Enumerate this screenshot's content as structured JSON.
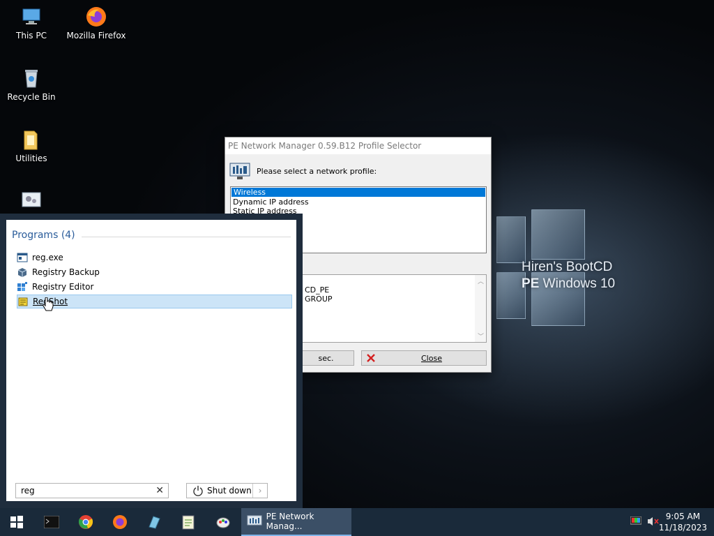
{
  "desktop": {
    "icons": [
      {
        "label": "This PC",
        "icon": "computer-icon"
      },
      {
        "label": "Mozilla Firefox",
        "icon": "firefox-icon"
      },
      {
        "label": "Recycle Bin",
        "icon": "recycle-bin-icon"
      },
      {
        "label": "Utilities",
        "icon": "folder-icon"
      }
    ],
    "brand": {
      "line1": "Hiren's BootCD",
      "line2": "PE Windows 10"
    }
  },
  "dialog": {
    "title": "PE Network Manager 0.59.B12 Profile Selector",
    "prompt": "Please select a network profile:",
    "profiles": [
      "Wireless",
      "Dynamic IP address",
      "Static IP address"
    ],
    "selected_profile": "Wireless",
    "info_lines": [
      "CD_PE",
      "GROUP"
    ],
    "partial_button": "sec.",
    "close_button": "Close"
  },
  "start_menu": {
    "section_title": "Programs (4)",
    "programs": [
      {
        "label": "reg.exe",
        "icon": "exe-icon"
      },
      {
        "label": "Registry Backup",
        "icon": "registry-backup-icon"
      },
      {
        "label": "Registry Editor",
        "icon": "registry-editor-icon"
      },
      {
        "label": "RegShot",
        "icon": "regshot-icon"
      }
    ],
    "highlighted": "RegShot",
    "search_value": "reg",
    "shutdown_label": "Shut down"
  },
  "taskbar": {
    "pinned": [
      "start-icon",
      "cmd-icon",
      "chrome-icon",
      "firefox-icon",
      "tool-icon",
      "notepad-icon",
      "paint-icon"
    ],
    "active_task": "PE Network Manag...",
    "time": "9:05 AM",
    "date": "11/18/2023"
  }
}
